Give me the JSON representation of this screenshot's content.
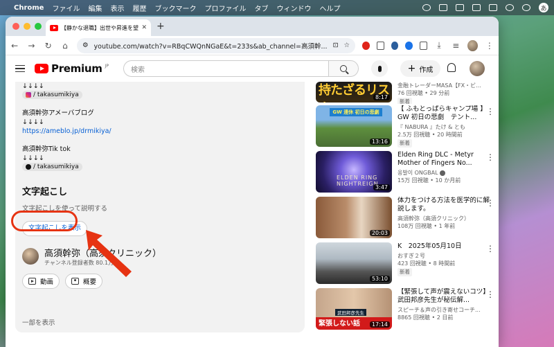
{
  "menubar": {
    "app": "Chrome",
    "items": [
      "ファイル",
      "編集",
      "表示",
      "履歴",
      "ブックマーク",
      "プロファイル",
      "タブ",
      "ウィンドウ",
      "ヘルプ"
    ],
    "input_indicator": "あ"
  },
  "browser": {
    "tab_title": "【静かな退職】出世や昇進を望まない",
    "url": "youtube.com/watch?v=RBqCWQnNGaE&t=233s&ab_channel=高須幹..."
  },
  "youtube": {
    "logo_text": "Premium",
    "logo_region": "JP",
    "search_placeholder": "検索",
    "create_label": "作成"
  },
  "description": {
    "lines": {
      "arrows_1": "↓↓↓↓",
      "handle_1": "/ takasumikiya",
      "blog_label": "高須幹弥アメーバブログ",
      "arrows_2": "↓↓↓↓",
      "blog_url": "https://ameblo.jp/drmikiya/",
      "tiktok_label": "高須幹弥Tik tok",
      "arrows_3": "↓↓↓↓",
      "handle_2": "/ takasumikiya"
    },
    "transcript": {
      "title": "文字起こし",
      "subtitle": "文字起こしを使って説明する",
      "button": "文字起こしを表示"
    },
    "channel": {
      "name": "高須幹弥（高須クリニック）",
      "subscribers": "チャンネル登録者数 80.1万人"
    },
    "pills": {
      "videos": "動画",
      "about": "概要"
    },
    "show_less": "一部を表示"
  },
  "recommendations": [
    {
      "thumb_text": "持たざるリスク",
      "title": "",
      "channel": "金融トレーダーMASA【FX・ビ...",
      "meta": "76 回視聴 • 29 分前",
      "badge": "新着",
      "duration": "8:17"
    },
    {
      "thumb_text": "GW 連休 初日の悲劇",
      "title": "【 ふもとっぱらキャンプ場 】GW 初日の悲劇　テント...",
      "channel": "『 NABURA 』たけ & とも",
      "meta": "2.5万 回視聴 • 20 時間前",
      "badge": "新着",
      "duration": "13:16"
    },
    {
      "thumb_text": "ELDEN RING NIGHTREIGN",
      "title": "Elden Ring DLC - Metyr Mother of Fingers No...",
      "channel": "옹발이 ONGBAL",
      "meta": "15万 回視聴 • 10 か月前",
      "badge": "",
      "duration": "3:47"
    },
    {
      "thumb_text": "",
      "title": "体力をつける方法を医学的に解説します。",
      "channel": "高須幹弥（高須クリニック）",
      "meta": "108万 回視聴 • 1 年前",
      "badge": "",
      "duration": "20:03"
    },
    {
      "thumb_text": "",
      "title": "K　2025年05月10日",
      "channel": "おすぎ２号",
      "meta": "423 回視聴 • 8 時間前",
      "badge": "新着",
      "duration": "53:10"
    },
    {
      "thumb_text": "緊張しない話",
      "thumb_tag": "武田邦彦先生",
      "title": "【緊張して声が震えないコツ】武田邦彦先生が秘伝解...",
      "channel": "スピーチ＆声の引き寄せコーチ...",
      "meta": "8865 回視聴 • 2 日前",
      "badge": "",
      "duration": "17:14"
    }
  ],
  "colors": {
    "yt_red": "#ff0000",
    "link_blue": "#065fd4",
    "highlight_red": "#e63312"
  }
}
